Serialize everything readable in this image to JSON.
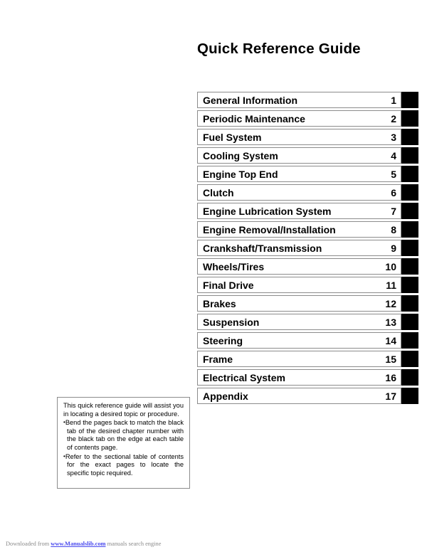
{
  "page": {
    "title": "Quick Reference Guide"
  },
  "chapter_index": {
    "rows": [
      {
        "name": "General Information",
        "number": "1"
      },
      {
        "name": "Periodic Maintenance",
        "number": "2"
      },
      {
        "name": "Fuel System",
        "number": "3"
      },
      {
        "name": "Cooling System",
        "number": "4"
      },
      {
        "name": "Engine Top End",
        "number": "5"
      },
      {
        "name": "Clutch",
        "number": "6"
      },
      {
        "name": "Engine Lubrication System",
        "number": "7"
      },
      {
        "name": "Engine Removal/Installation",
        "number": "8"
      },
      {
        "name": "Crankshaft/Transmission",
        "number": "9"
      },
      {
        "name": "Wheels/Tires",
        "number": "10"
      },
      {
        "name": "Final Drive",
        "number": "11"
      },
      {
        "name": "Brakes",
        "number": "12"
      },
      {
        "name": "Suspension",
        "number": "13"
      },
      {
        "name": "Steering",
        "number": "14"
      },
      {
        "name": "Frame",
        "number": "15"
      },
      {
        "name": "Electrical System",
        "number": "16"
      },
      {
        "name": "Appendix",
        "number": "17"
      }
    ]
  },
  "note_box": {
    "intro": "This quick reference guide will assist you in locating a desired topic or procedure.",
    "bullets": [
      "Bend the pages back to match the black tab of the desired chapter number with the black tab on the edge at each table of contents page.",
      "Refer to the sectional table of contents for the exact pages to locate the specific topic required."
    ],
    "bullet_glyph": "•"
  },
  "footer": {
    "prefix": "Downloaded from ",
    "link": "www.Manualslib.com",
    "suffix": " manuals search engine",
    "link_color": "#4a4aee"
  }
}
